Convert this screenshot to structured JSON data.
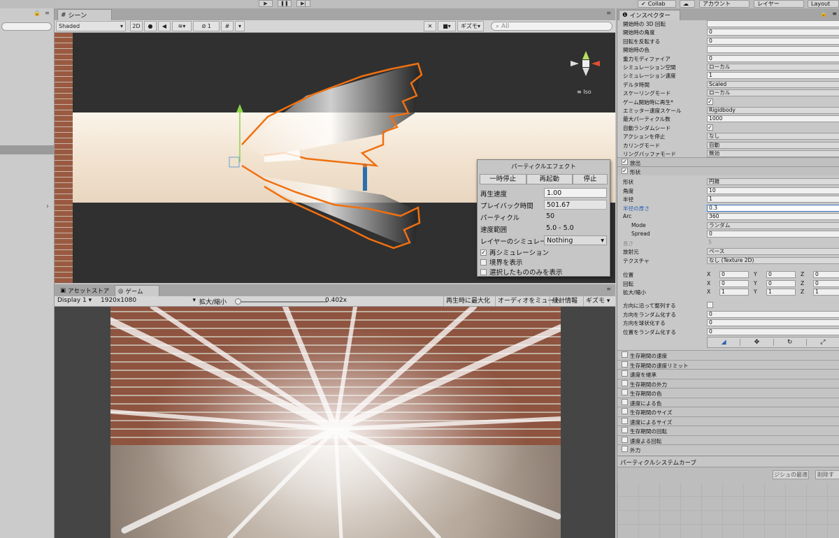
{
  "top": {
    "play": "▶",
    "pause": "❚❚",
    "step": "▶|",
    "collab": "Collab",
    "account": "アカウント",
    "layers": "レイヤー",
    "layout": "Layout"
  },
  "scene": {
    "tab": "シーン",
    "shading": "Shaded",
    "btn_2d": "2D",
    "hidden_count": "1",
    "gizmos": "ギズモ",
    "search_placeholder": "All",
    "iso": "Iso"
  },
  "effect": {
    "title": "パーティクルエフェクト",
    "pause": "一時停止",
    "restart": "再起動",
    "stop": "停止",
    "rows": [
      {
        "label": "再生速度",
        "value": "1.00"
      },
      {
        "label": "プレイバック時間",
        "value": "501.67"
      },
      {
        "label": "パーティクル",
        "value": "50"
      },
      {
        "label": "速度範囲",
        "value": "5.0 - 5.0"
      },
      {
        "label": "レイヤーのシミュレーション",
        "value": "Nothing"
      }
    ],
    "checks": [
      {
        "label": "再シミュレーション",
        "checked": true
      },
      {
        "label": "境界を表示",
        "checked": false
      },
      {
        "label": "選択したもののみを表示",
        "checked": false
      }
    ]
  },
  "bottomtabs": {
    "asset": "アセットストア",
    "game": "ゲーム"
  },
  "game": {
    "display": "Display 1",
    "resolution": "1920x1080",
    "scale_label": "拡大/縮小",
    "scale_value": "0.402x",
    "maximize": "再生時に最大化",
    "mute": "オーディオをミュート",
    "stats": "統計情報",
    "gizmos": "ギズモ"
  },
  "inspector": {
    "title": "インスペクター",
    "main": [
      {
        "label": "開始時の 3D 回転",
        "value": ""
      },
      {
        "label": "開始時の角度",
        "value": "0"
      },
      {
        "label": "回転を反転する",
        "value": "0"
      },
      {
        "label": "開始時の色",
        "value": ""
      },
      {
        "label": "重力モディファイア",
        "value": "0"
      },
      {
        "label": "シミュレーション空間",
        "value": "ローカル"
      },
      {
        "label": "シミュレーション速度",
        "value": "1"
      },
      {
        "label": "デルタ時間",
        "value": "Scaled"
      },
      {
        "label": "スケーリングモード",
        "value": "ローカル"
      },
      {
        "label": "ゲーム開始時に再生*",
        "value": "✓"
      },
      {
        "label": "エミッター速度スケール",
        "value": "Rigidbody"
      },
      {
        "label": "最大パーティクル数",
        "value": "1000"
      },
      {
        "label": "自動ランダムシード",
        "value": "✓"
      },
      {
        "label": "アクションを停止",
        "value": "なし"
      },
      {
        "label": "カリングモード",
        "value": "自動"
      },
      {
        "label": "リングバッファモード",
        "value": "無効"
      }
    ],
    "emission": "放出",
    "shape": "形状",
    "shape_props": [
      {
        "label": "形状",
        "value": "円錐"
      },
      {
        "label": "角度",
        "value": "10"
      },
      {
        "label": "半径",
        "value": "1"
      },
      {
        "label": "半径の厚さ",
        "value": "0.3"
      },
      {
        "label": "Arc",
        "value": "360"
      },
      {
        "label": "Mode",
        "value": "ランダム"
      },
      {
        "label": "Spread",
        "value": "0"
      },
      {
        "label": "長さ",
        "value": "5"
      },
      {
        "label": "放射元",
        "value": "ベース"
      },
      {
        "label": "テクスチャ",
        "value": "なし (Texture 2D)"
      }
    ],
    "transform": [
      {
        "label": "位置",
        "x": "0",
        "y": "0",
        "z": "0"
      },
      {
        "label": "回転",
        "x": "0",
        "y": "0",
        "z": "0"
      },
      {
        "label": "拡大/縮小",
        "x": "1",
        "y": "1",
        "z": "1"
      }
    ],
    "axis": {
      "x": "X",
      "y": "Y",
      "z": "Z"
    },
    "align": [
      {
        "label": "方向に沿って整列する",
        "value": ""
      },
      {
        "label": "方向をランダム化する",
        "value": "0"
      },
      {
        "label": "方向を球状化する",
        "value": "0"
      },
      {
        "label": "位置をランダム化する",
        "value": "0"
      }
    ],
    "modules": [
      "生存期間の速度",
      "生存期間の速度リミット",
      "速度を継承",
      "生存期間の外力",
      "生存期間の色",
      "速度による色",
      "生存期間のサイズ",
      "速度によるサイズ",
      "生存期間の回転",
      "速度よる回転",
      "外力"
    ],
    "curves_title": "パーティクルシステムカーブ",
    "optimize": "ジシュの最適",
    "delete": "削除す"
  }
}
